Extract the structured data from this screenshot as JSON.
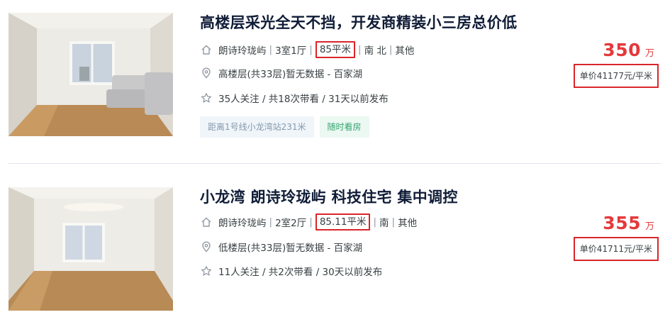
{
  "listings": [
    {
      "title": "高楼层采光全天不挡，开发商精装小三房总价低",
      "community": "朗诗玲珑屿",
      "layout": "3室1厅",
      "area": "85平米",
      "orientation": "南 北",
      "decoration": "其他",
      "position": "高楼层(共33层)暂无数据 - 百家湖",
      "follow": "35人关注 / 共18次带看 / 31天以前发布",
      "tags": [
        "距离1号线小龙湾站231米",
        "随时看房"
      ],
      "price": "350",
      "price_unit": "万",
      "unit_price": "单价41177元/平米"
    },
    {
      "title": "小龙湾 朗诗玲珑屿 科技住宅 集中调控",
      "community": "朗诗玲珑屿",
      "layout": "2室2厅",
      "area": "85.11平米",
      "orientation": "南",
      "decoration": "其他",
      "position": "低楼层(共33层)暂无数据 - 百家湖",
      "follow": "11人关注 / 共2次带看 / 30天以前发布",
      "tags": [],
      "price": "355",
      "price_unit": "万",
      "unit_price": "单价41711元/平米"
    }
  ],
  "icons": {
    "house": "house-icon",
    "location": "location-pin-icon",
    "follow": "star-icon"
  },
  "colors": {
    "price": "#e4393c",
    "highlight_box": "#d9262b",
    "title": "#101d37",
    "tag_visit": "#33a570"
  }
}
